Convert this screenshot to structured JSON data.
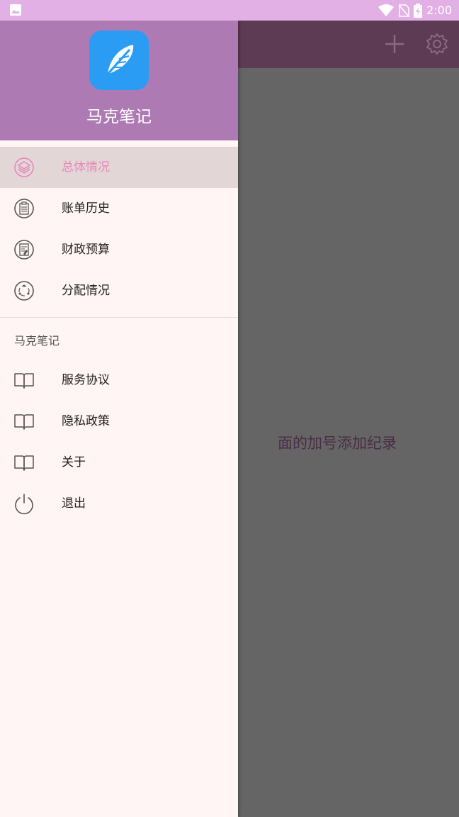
{
  "status_bar": {
    "time": "2:00"
  },
  "app_header": {
    "empty_hint": "面的加号添加纪录"
  },
  "drawer": {
    "app_name": "马克笔记",
    "main_items": [
      {
        "label": "总体情况",
        "icon": "layers-icon",
        "active": true
      },
      {
        "label": "账单历史",
        "icon": "clipboard-icon",
        "active": false
      },
      {
        "label": "财政预算",
        "icon": "budget-doc-icon",
        "active": false
      },
      {
        "label": "分配情况",
        "icon": "distribution-icon",
        "active": false
      }
    ],
    "section_title": "马克笔记",
    "secondary_items": [
      {
        "label": "服务协议",
        "icon": "book-icon"
      },
      {
        "label": "隐私政策",
        "icon": "book-icon"
      },
      {
        "label": "关于",
        "icon": "book-icon"
      },
      {
        "label": "退出",
        "icon": "power-icon"
      }
    ]
  },
  "colors": {
    "status_bar": "#e3b0e5",
    "drawer_header": "#ad7ab4",
    "active_item_text": "#e588b9",
    "active_item_bg": "#e3d6d6",
    "drawer_bg": "#fff5f4",
    "logo_bg": "#2a9cf4"
  }
}
